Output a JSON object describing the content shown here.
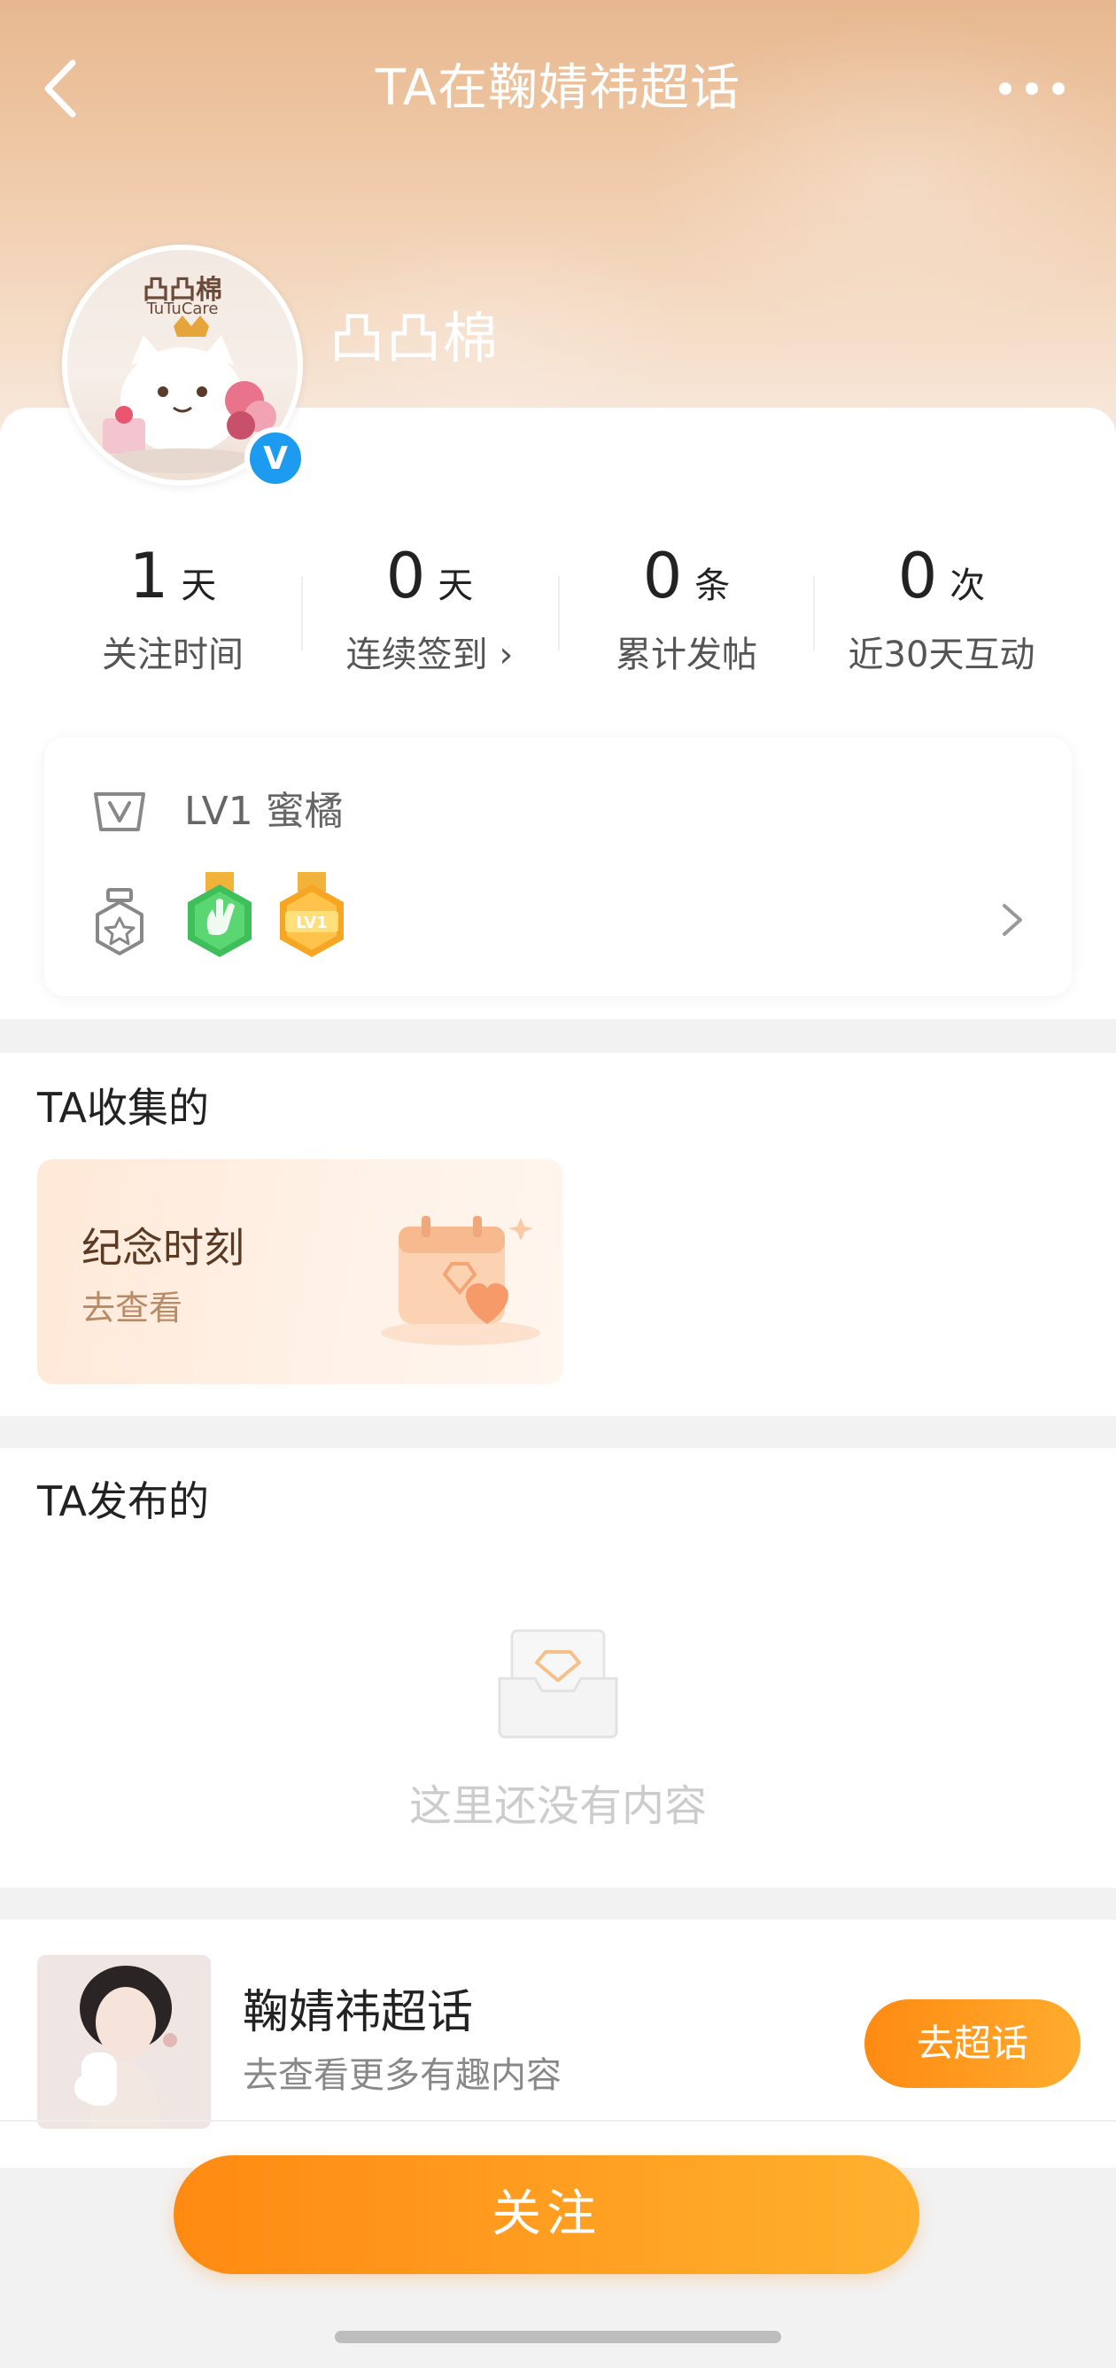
{
  "nav": {
    "title": "TA在鞠婧祎超话"
  },
  "profile": {
    "username": "凸凸棉",
    "avatar_logo": "凸凸棉",
    "avatar_sub": "TuTuCare",
    "verified_mark": "V"
  },
  "stats": [
    {
      "value": "1",
      "unit": "天",
      "label": "关注时间"
    },
    {
      "value": "0",
      "unit": "天",
      "label": "连续签到 ›"
    },
    {
      "value": "0",
      "unit": "条",
      "label": "累计发帖"
    },
    {
      "value": "0",
      "unit": "次",
      "label": "近30天互动"
    }
  ],
  "level": {
    "text": "LV1 蜜橘",
    "medal_text": "LV1"
  },
  "collected": {
    "title": "TA收集的",
    "card_title": "纪念时刻",
    "card_link": "去查看"
  },
  "posted": {
    "title": "TA发布的",
    "empty_text": "这里还没有内容"
  },
  "topic": {
    "name": "鞠婧祎超话",
    "subtitle": "去查看更多有趣内容",
    "button": "去超话"
  },
  "follow_button": "关注",
  "colors": {
    "accent": "#ff9a1e",
    "verified": "#1d9bf0",
    "hero_top": "#e7b88f"
  },
  "icons": {
    "back": "chevron-left-icon",
    "more": "more-dots-icon",
    "level": "crown-shield-icon",
    "badge": "badge-hexagon-icon",
    "chevron": "chevron-right-icon"
  }
}
